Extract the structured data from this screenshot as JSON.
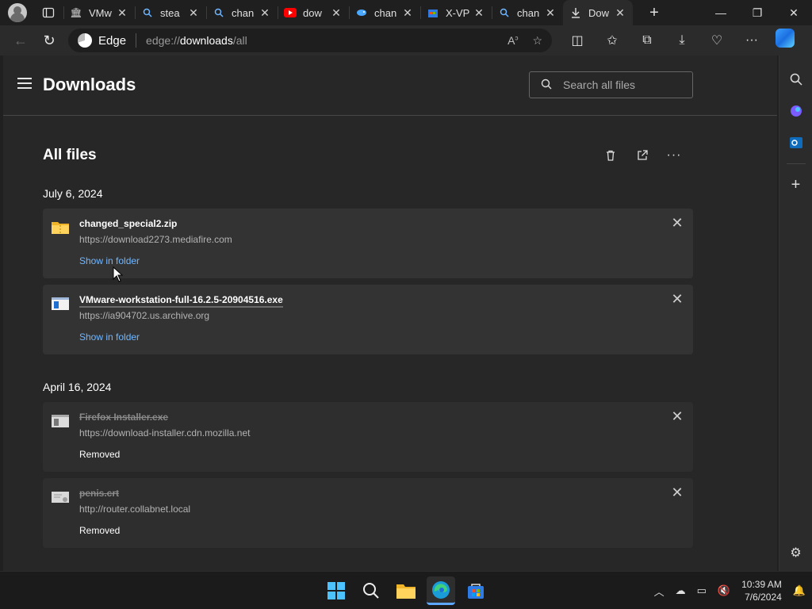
{
  "browser": {
    "tabs": [
      {
        "title": "VMw",
        "favicon": "archive-icon"
      },
      {
        "title": "stea",
        "favicon": "search-icon"
      },
      {
        "title": "chan",
        "favicon": "search-icon"
      },
      {
        "title": "dow",
        "favicon": "youtube-icon"
      },
      {
        "title": "chan",
        "favicon": "fish-icon"
      },
      {
        "title": "X-VP",
        "favicon": "store-icon"
      },
      {
        "title": "chan",
        "favicon": "search-icon"
      },
      {
        "title": "Dow",
        "favicon": "download-icon",
        "active": true
      }
    ],
    "brand": "Edge",
    "url_scheme": "edge://",
    "url_host": "downloads",
    "url_path": "/all"
  },
  "downloads": {
    "page_title": "Downloads",
    "search_placeholder": "Search all files",
    "section_title": "All files",
    "groups": [
      {
        "date": "July 6, 2024",
        "items": [
          {
            "name": "changed_special2.zip",
            "source": "https://download2273.mediafire.com",
            "action": "Show in folder",
            "icon": "folder-zip-icon",
            "removed": false
          },
          {
            "name": "VMware-workstation-full-16.2.5-20904516.exe",
            "source": "https://ia904702.us.archive.org",
            "action": "Show in folder",
            "icon": "installer-icon",
            "removed": false
          }
        ]
      },
      {
        "date": "April 16, 2024",
        "items": [
          {
            "name": "Firefox Installer.exe",
            "source": "https://download-installer.cdn.mozilla.net",
            "action": "Removed",
            "icon": "installer-icon",
            "removed": true
          },
          {
            "name": "penis.crt",
            "source": "http://router.collabnet.local",
            "action": "Removed",
            "icon": "certificate-icon",
            "removed": true
          }
        ]
      }
    ]
  },
  "taskbar": {
    "time": "10:39 AM",
    "date": "7/6/2024"
  },
  "colors": {
    "accent_link": "#72b7ff",
    "background": "#272727",
    "card": "#333333"
  }
}
